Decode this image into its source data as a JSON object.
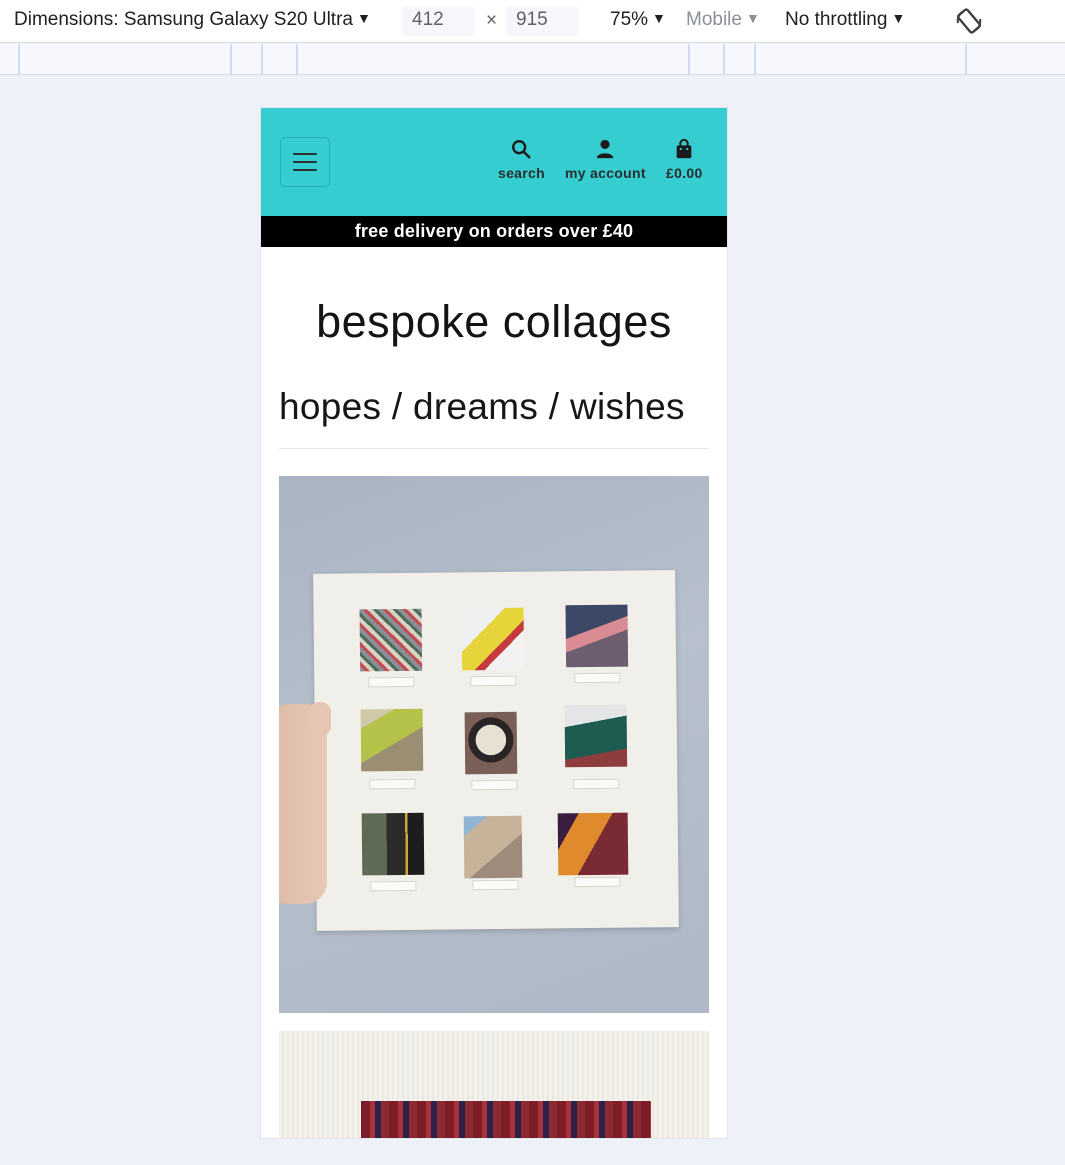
{
  "devtools": {
    "dimensions_label": "Dimensions: Samsung Galaxy S20 Ultra",
    "width": "412",
    "times": "×",
    "height": "915",
    "zoom": "75%",
    "device_type": "Mobile",
    "throttling": "No throttling",
    "caret": "▼"
  },
  "site": {
    "header_color": "#35cdd0",
    "nav": {
      "search_label": "search",
      "account_label": "my account",
      "cart_total": "£0.00"
    },
    "banner_text": "free delivery on orders over £40",
    "page_title": "bespoke collages",
    "product_title": "hopes / dreams / wishes"
  }
}
